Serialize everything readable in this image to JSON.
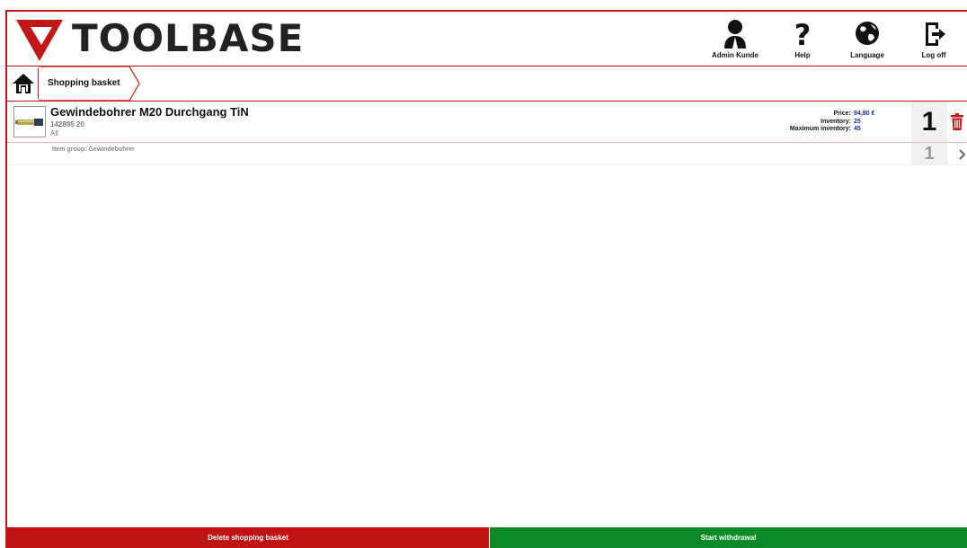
{
  "app": {
    "logo_text": "TOOLBASE"
  },
  "header": {
    "buttons": [
      {
        "label": "Admin Kunde",
        "icon": "user-icon"
      },
      {
        "label": "Help",
        "icon": "question-icon"
      },
      {
        "label": "Language",
        "icon": "globe-icon"
      },
      {
        "label": "Log off",
        "icon": "logout-icon"
      }
    ]
  },
  "breadcrumb": {
    "home_icon": "home-icon",
    "current": "Shopping basket"
  },
  "basket": {
    "items": [
      {
        "title": "Gewindebohrer M20 Durchgang TiN",
        "number": "142895 20",
        "scope": "All",
        "price_label": "Price:",
        "price": "94,80 €",
        "inventory_label": "Inventory:",
        "inventory": "25",
        "max_inventory_label": "Maximum inventory:",
        "max_inventory": "45",
        "quantity": "1"
      }
    ],
    "groups": [
      {
        "label": "Item group: Gewindebohrer",
        "quantity": "1"
      }
    ]
  },
  "footer": {
    "delete_label": "Delete shopping basket",
    "start_label": "Start withdrawal"
  },
  "colors": {
    "brand_red": "#c01717",
    "start_green": "#0c8a28",
    "value_blue": "#1b2fa8"
  }
}
